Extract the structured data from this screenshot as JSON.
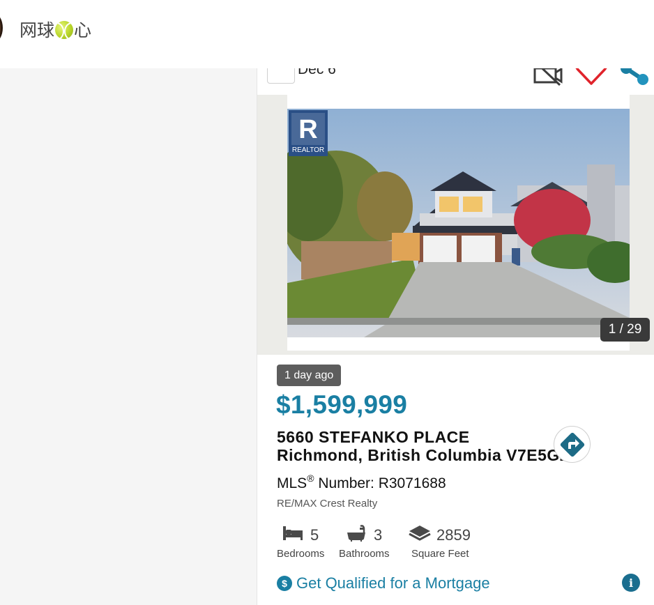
{
  "header": {
    "username_part1": "网球",
    "username_emoji": "tennis-ball-emoji",
    "username_part2": "心"
  },
  "listing": {
    "date_label": "Dec 6",
    "photo_counter": "1 / 29",
    "logo_text": "REALTOR",
    "posted": "1 day ago",
    "price": "$1,599,999",
    "address_line1": "5660 STEFANKO PLACE",
    "address_line2": "Richmond, British Columbia V7E5G2",
    "mls_prefix": "MLS",
    "mls_reg": "®",
    "mls_suffix": " Number: R3071688",
    "brokerage": "RE/MAX Crest Realty",
    "stats": {
      "bedrooms_value": "5",
      "bedrooms_label": "Bedrooms",
      "bathrooms_value": "3",
      "bathrooms_label": "Bathrooms",
      "sqft_value": "2859",
      "sqft_label": "Square Feet"
    },
    "mortgage_link": "Get Qualified for a Mortgage",
    "dollar_symbol": "$",
    "info_symbol": "i"
  },
  "colors": {
    "accent": "#1a7fa3",
    "heart": "#e0232b",
    "badge_bg": "#5d5d5d",
    "counter_bg": "#3a3a3a",
    "directions": "#1d6b86"
  },
  "icons": [
    "no-camera-icon",
    "heart-icon",
    "share-dots-icon",
    "realtor-logo",
    "directions-icon",
    "bed-icon",
    "bathtub-icon",
    "area-icon",
    "dollar-icon",
    "info-icon"
  ]
}
